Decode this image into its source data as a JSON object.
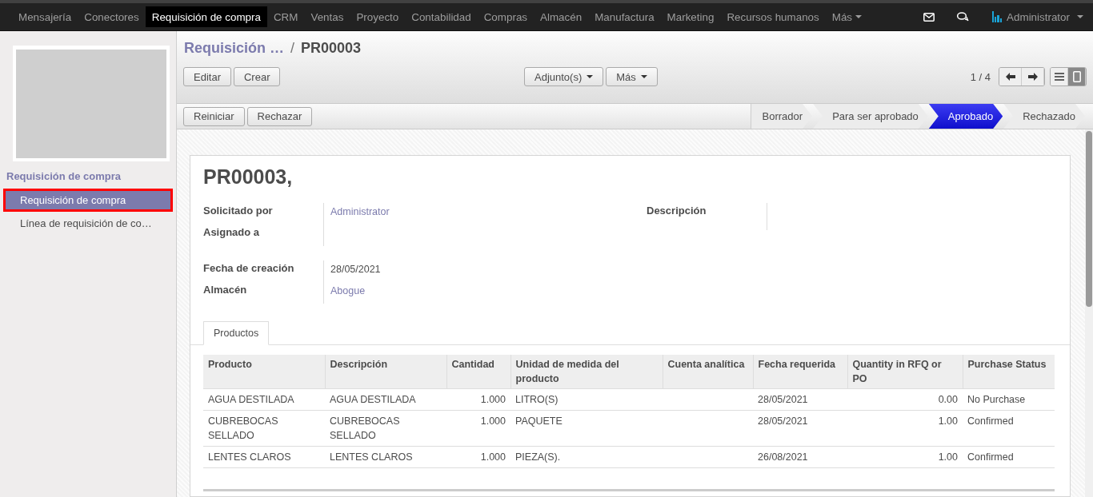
{
  "top_menu": {
    "items": [
      {
        "label": "Mensajería",
        "selected": false
      },
      {
        "label": "Conectores",
        "selected": false
      },
      {
        "label": "Requisición de compra",
        "selected": true
      },
      {
        "label": "CRM",
        "selected": false
      },
      {
        "label": "Ventas",
        "selected": false
      },
      {
        "label": "Proyecto",
        "selected": false
      },
      {
        "label": "Contabilidad",
        "selected": false
      },
      {
        "label": "Compras",
        "selected": false
      },
      {
        "label": "Almacén",
        "selected": false
      },
      {
        "label": "Manufactura",
        "selected": false
      },
      {
        "label": "Marketing",
        "selected": false
      },
      {
        "label": "Recursos humanos",
        "selected": false
      }
    ],
    "more": "Más",
    "user": "Administrator"
  },
  "sidebar": {
    "section": "Requisición de compra",
    "items": [
      {
        "label": "Requisición de compra",
        "selected": true,
        "highlighted": true
      },
      {
        "label": "Línea de requisición de co…",
        "selected": false,
        "highlighted": false
      }
    ]
  },
  "breadcrumb": {
    "parent": "Requisición …",
    "separator": "/",
    "current": "PR00003"
  },
  "toolbar": {
    "buttons": [
      "Editar",
      "Crear"
    ],
    "dropdowns": [
      "Adjunto(s)",
      "Más"
    ],
    "pager": "1 / 4",
    "views": [
      {
        "kind": "list",
        "selected": false
      },
      {
        "kind": "form",
        "selected": true
      }
    ]
  },
  "actions": [
    "Reiniciar",
    "Rechazar"
  ],
  "stages": [
    {
      "label": "Borrador",
      "selected": false
    },
    {
      "label": "Para ser aprobado",
      "selected": false
    },
    {
      "label": "Aprobado",
      "selected": true
    },
    {
      "label": "Rechazado",
      "selected": false
    }
  ],
  "form": {
    "title": "PR00003,",
    "left_groups": [
      [
        {
          "label": "Solicitado por",
          "value": "Administrator",
          "kind": "link"
        },
        {
          "label": "Asignado a",
          "kind": "empty"
        }
      ],
      [
        {
          "label": "Fecha de creación",
          "value": "28/05/2021",
          "kind": "text"
        },
        {
          "label": "Almacén",
          "value": "Abogue",
          "kind": "link"
        }
      ]
    ],
    "right_fields": [
      {
        "label": "Descripción"
      }
    ],
    "tabs": [
      {
        "label": "Productos",
        "selected": true
      }
    ],
    "table": {
      "columns": [
        "Producto",
        "Descripción",
        "Cantidad",
        "Unidad de medida del producto",
        "Cuenta analítica",
        "Fecha requerida",
        "Quantity in RFQ or PO",
        "Purchase Status"
      ],
      "rows": [
        [
          "AGUA DESTILADA",
          "AGUA DESTILADA",
          "1.000",
          "LITRO(S)",
          "",
          "28/05/2021",
          "0.00",
          "No Purchase"
        ],
        [
          "CUBREBOCAS SELLADO",
          "CUBREBOCAS SELLADO",
          "1.000",
          "PAQUETE",
          "",
          "28/05/2021",
          "1.00",
          "Confirmed"
        ],
        [
          "LENTES CLAROS",
          "LENTES CLAROS",
          "1.000",
          "PIEZA(S).",
          "",
          "26/08/2021",
          "1.00",
          "Confirmed"
        ]
      ]
    }
  }
}
